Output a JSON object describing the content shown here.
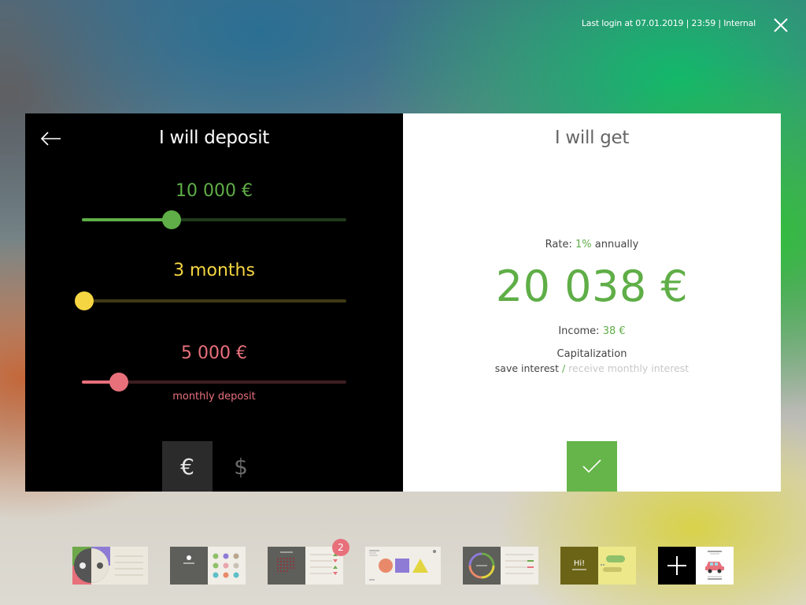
{
  "header": {
    "last_login": "Last login at 07.01.2019 | 23:59 | Internal",
    "close_icon": "close-icon"
  },
  "deposit_panel": {
    "title": "I will deposit",
    "back_icon": "arrow-left-icon",
    "amount": {
      "label": "10 000 €",
      "color": "#5fae47",
      "level": 0.34
    },
    "term": {
      "label": "3 months",
      "color": "#f5d642",
      "level": 0.01
    },
    "monthly": {
      "label": "5 000 €",
      "sublabel": "monthly deposit",
      "color": "#e8707b",
      "level": 0.14
    },
    "currencies": [
      {
        "symbol": "€",
        "selected": true
      },
      {
        "symbol": "$",
        "selected": false
      }
    ]
  },
  "result_panel": {
    "title": "I will get",
    "rate_prefix": "Rate:",
    "rate_value": "1%",
    "rate_suffix": "annually",
    "total": "20 038 €",
    "income_prefix": "Income:",
    "income_value": "38 €",
    "capitalization_title": "Capitalization",
    "option_save": "save interest",
    "separator": "/",
    "option_receive": "receive monthly interest",
    "confirm_icon": "checkmark-icon",
    "accent_color": "#66b54a"
  },
  "dock": {
    "apps": [
      {
        "name": "face-app"
      },
      {
        "name": "profile-app"
      },
      {
        "name": "calendar-app",
        "badge": "2"
      },
      {
        "name": "shapes-app"
      },
      {
        "name": "gauge-app"
      },
      {
        "name": "chat-app",
        "greeting": "Hi!"
      },
      {
        "name": "add-car-app"
      }
    ]
  }
}
